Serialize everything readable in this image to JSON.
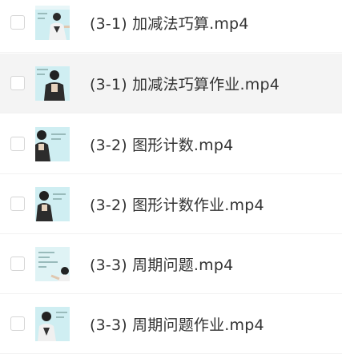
{
  "files": [
    {
      "name": "(3-1) 加减法巧算.mp4"
    },
    {
      "name": "(3-1) 加减法巧算作业.mp4"
    },
    {
      "name": "(3-2) 图形计数.mp4"
    },
    {
      "name": "(3-2) 图形计数作业.mp4"
    },
    {
      "name": "(3-3) 周期问题.mp4"
    },
    {
      "name": "(3-3) 周期问题作业.mp4"
    }
  ],
  "colors": {
    "board": "#cfeef2",
    "hover_row": "#f4f4f4",
    "text": "#333333"
  }
}
